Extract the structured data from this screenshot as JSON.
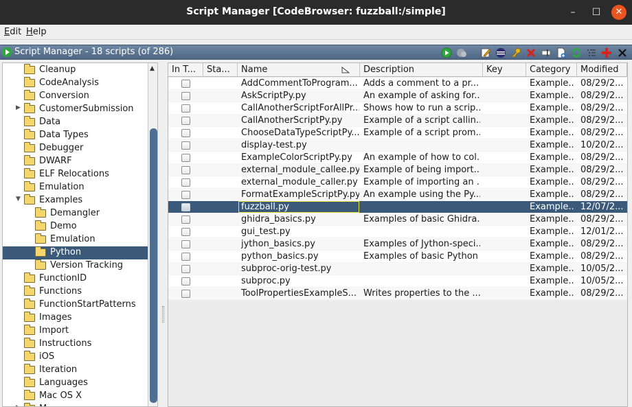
{
  "window": {
    "title": "Script Manager [CodeBrowser: fuzzball:/simple]",
    "minimize_glyph": "–",
    "maximize_glyph": "☐",
    "close_glyph": "✕"
  },
  "menu": [
    {
      "accel": "E",
      "rest": "dit"
    },
    {
      "accel": "H",
      "rest": "elp"
    }
  ],
  "component": {
    "title": "Script Manager - 18 scripts  (of 286)",
    "toolbar_icons": [
      "run-script-icon",
      "run-last-script-icon",
      "edit-script-icon",
      "edit-eclipse-icon",
      "key-binding-icon",
      "delete-script-icon",
      "rename-script-icon",
      "new-script-icon",
      "refresh-icon",
      "script-directories-icon",
      "help-icon",
      "close-panel-icon"
    ]
  },
  "tree": {
    "items": [
      {
        "label": "Cleanup",
        "level": 0,
        "expander": ""
      },
      {
        "label": "CodeAnalysis",
        "level": 0,
        "expander": ""
      },
      {
        "label": "Conversion",
        "level": 0,
        "expander": ""
      },
      {
        "label": "CustomerSubmission",
        "level": 0,
        "expander": "▶"
      },
      {
        "label": "Data",
        "level": 0,
        "expander": ""
      },
      {
        "label": "Data Types",
        "level": 0,
        "expander": ""
      },
      {
        "label": "Debugger",
        "level": 0,
        "expander": ""
      },
      {
        "label": "DWARF",
        "level": 0,
        "expander": ""
      },
      {
        "label": "ELF Relocations",
        "level": 0,
        "expander": ""
      },
      {
        "label": "Emulation",
        "level": 0,
        "expander": ""
      },
      {
        "label": "Examples",
        "level": 0,
        "expander": "▼"
      },
      {
        "label": "Demangler",
        "level": 1,
        "expander": ""
      },
      {
        "label": "Demo",
        "level": 1,
        "expander": ""
      },
      {
        "label": "Emulation",
        "level": 1,
        "expander": ""
      },
      {
        "label": "Python",
        "level": 1,
        "expander": "",
        "selected": true
      },
      {
        "label": "Version Tracking",
        "level": 1,
        "expander": ""
      },
      {
        "label": "FunctionID",
        "level": 0,
        "expander": ""
      },
      {
        "label": "Functions",
        "level": 0,
        "expander": ""
      },
      {
        "label": "FunctionStartPatterns",
        "level": 0,
        "expander": ""
      },
      {
        "label": "Images",
        "level": 0,
        "expander": ""
      },
      {
        "label": "Import",
        "level": 0,
        "expander": ""
      },
      {
        "label": "Instructions",
        "level": 0,
        "expander": ""
      },
      {
        "label": "iOS",
        "level": 0,
        "expander": ""
      },
      {
        "label": "Iteration",
        "level": 0,
        "expander": ""
      },
      {
        "label": "Languages",
        "level": 0,
        "expander": ""
      },
      {
        "label": "Mac OS X",
        "level": 0,
        "expander": ""
      },
      {
        "label": "M...",
        "level": 0,
        "expander": "▶"
      }
    ]
  },
  "table": {
    "columns": [
      "In T...",
      "Sta...",
      "Name",
      "Description",
      "Key",
      "Category",
      "Modified"
    ],
    "rows": [
      {
        "name": "AddCommentToProgram...",
        "description": "Adds a comment to a pr...",
        "key": "",
        "category": "Example...",
        "modified": "08/29/2..."
      },
      {
        "name": "AskScriptPy.py",
        "description": "An example of asking for...",
        "key": "",
        "category": "Example...",
        "modified": "08/29/2..."
      },
      {
        "name": "CallAnotherScriptForAllPr...",
        "description": "Shows how to run a scrip...",
        "key": "",
        "category": "Example...",
        "modified": "08/29/2..."
      },
      {
        "name": "CallAnotherScriptPy.py",
        "description": "Example of a script callin...",
        "key": "",
        "category": "Example...",
        "modified": "08/29/2..."
      },
      {
        "name": "ChooseDataTypeScriptPy...",
        "description": "Example of a script prom...",
        "key": "",
        "category": "Example...",
        "modified": "08/29/2..."
      },
      {
        "name": "display-test.py",
        "description": "",
        "key": "",
        "category": "Example...",
        "modified": "10/20/2..."
      },
      {
        "name": "ExampleColorScriptPy.py",
        "description": "An example of how to col...",
        "key": "",
        "category": "Example...",
        "modified": "08/29/2..."
      },
      {
        "name": "external_module_callee.py",
        "description": "Example of being import...",
        "key": "",
        "category": "Example...",
        "modified": "08/29/2..."
      },
      {
        "name": "external_module_caller.py",
        "description": "Example of importing an ...",
        "key": "",
        "category": "Example...",
        "modified": "08/29/2..."
      },
      {
        "name": "FormatExampleScriptPy.py",
        "description": "An example using the Py...",
        "key": "",
        "category": "Example...",
        "modified": "08/29/2..."
      },
      {
        "name": "fuzzball.py",
        "description": "",
        "key": "",
        "category": "Example...",
        "modified": "12/07/2...",
        "selected": true
      },
      {
        "name": "ghidra_basics.py",
        "description": "Examples of basic Ghidra...",
        "key": "",
        "category": "Example...",
        "modified": "08/29/2..."
      },
      {
        "name": "gui_test.py",
        "description": "",
        "key": "",
        "category": "Example...",
        "modified": "12/01/2..."
      },
      {
        "name": "jython_basics.py",
        "description": "Examples of Jython-speci...",
        "key": "",
        "category": "Example...",
        "modified": "08/29/2..."
      },
      {
        "name": "python_basics.py",
        "description": "Examples of basic Python",
        "key": "",
        "category": "Example...",
        "modified": "08/29/2..."
      },
      {
        "name": "subproc-orig-test.py",
        "description": "",
        "key": "",
        "category": "Example...",
        "modified": "10/05/2..."
      },
      {
        "name": "subproc.py",
        "description": "",
        "key": "",
        "category": "Example...",
        "modified": "10/05/2..."
      },
      {
        "name": "ToolPropertiesExampleS...",
        "description": "Writes properties to the ...",
        "key": "",
        "category": "Example...",
        "modified": "08/29/2..."
      }
    ]
  },
  "colors": {
    "selection": "#3b5a7a",
    "header_gradient_top": "#6e87a3",
    "header_gradient_bottom": "#4d6784",
    "run_green": "#2eaa3c",
    "delete_red": "#d9221c",
    "folder_yellow": "#f5d66b",
    "close_orange": "#e95420"
  }
}
